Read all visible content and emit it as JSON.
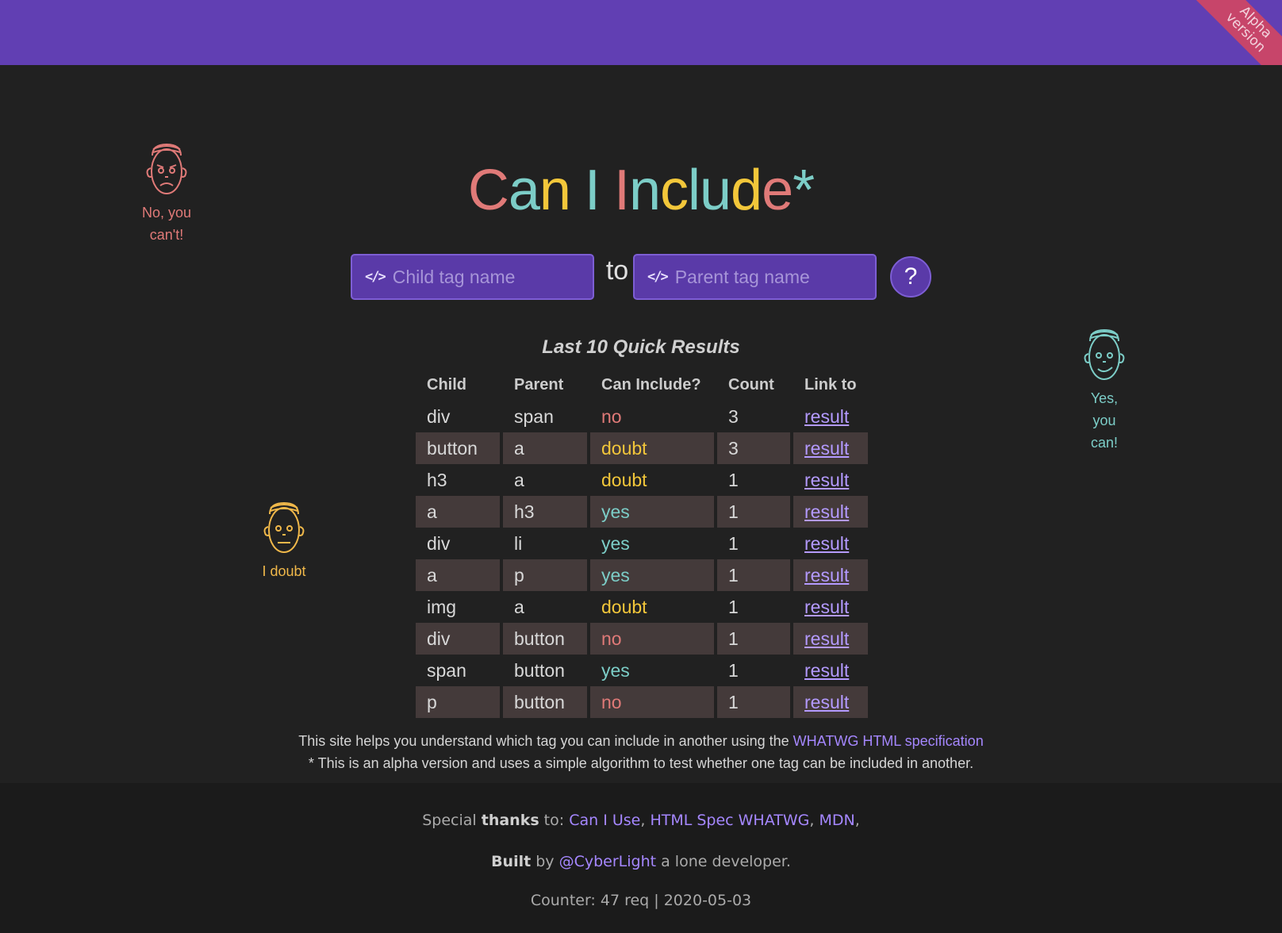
{
  "header": {
    "ribbon": "Alpha\nversion"
  },
  "title": {
    "letters": [
      "C",
      "a",
      "n",
      " ",
      "I",
      " ",
      "I",
      "n",
      "c",
      "l",
      "u",
      "d",
      "e",
      "*"
    ],
    "colors": [
      "#e07a78",
      "#7ccdc7",
      "#f3c73a",
      "",
      "#7ccdc7",
      "",
      "#e07a78",
      "#7ccdc7",
      "#f3c73a",
      "#7ccdc7",
      "#7ccdc7",
      "#f3c73a",
      "#e07a78",
      "#7ccdc7"
    ]
  },
  "search": {
    "child_placeholder": "Child tag name",
    "child_value": "",
    "to_label": "to",
    "parent_placeholder": "Parent tag name",
    "parent_value": "",
    "help_label": "?",
    "input_icon": "code-icon"
  },
  "faces": {
    "no": {
      "label": "No, you can't!",
      "color": "#e07a78"
    },
    "doubt": {
      "label": "I doubt",
      "color": "#f0b84a"
    },
    "yes": {
      "label": "Yes, you can!",
      "color": "#7ccdc7"
    }
  },
  "results": {
    "title": "Last 10 Quick Results",
    "headers": [
      "Child",
      "Parent",
      "Can Include?",
      "Count",
      "Link to"
    ],
    "rows": [
      {
        "child": "div",
        "parent": "span",
        "include": "no",
        "count": "3",
        "link": "result"
      },
      {
        "child": "button",
        "parent": "a",
        "include": "doubt",
        "count": "3",
        "link": "result"
      },
      {
        "child": "h3",
        "parent": "a",
        "include": "doubt",
        "count": "1",
        "link": "result"
      },
      {
        "child": "a",
        "parent": "h3",
        "include": "yes",
        "count": "1",
        "link": "result"
      },
      {
        "child": "div",
        "parent": "li",
        "include": "yes",
        "count": "1",
        "link": "result"
      },
      {
        "child": "a",
        "parent": "p",
        "include": "yes",
        "count": "1",
        "link": "result"
      },
      {
        "child": "img",
        "parent": "a",
        "include": "doubt",
        "count": "1",
        "link": "result"
      },
      {
        "child": "div",
        "parent": "button",
        "include": "no",
        "count": "1",
        "link": "result"
      },
      {
        "child": "span",
        "parent": "button",
        "include": "yes",
        "count": "1",
        "link": "result"
      },
      {
        "child": "p",
        "parent": "button",
        "include": "no",
        "count": "1",
        "link": "result"
      }
    ]
  },
  "info": {
    "line1_prefix": "This site helps you understand which tag you can include in another using the ",
    "line1_link": "WHATWG HTML specification",
    "line2": "* This is an alpha version and uses a simple algorithm to test whether one tag can be included in another."
  },
  "footer": {
    "thanks_prefix": "Special ",
    "thanks_bold": "thanks",
    "thanks_to": " to: ",
    "thanks_links": [
      "Can I Use",
      "HTML Spec WHATWG",
      "MDN"
    ],
    "built_bold": "Built",
    "built_by": " by ",
    "built_link": "@CyberLight",
    "built_suffix": " a lone developer.",
    "counter": "Counter: 47 req | 2020-05-03"
  },
  "colors": {
    "no": "#e07a78",
    "doubt": "#f3c73a",
    "yes": "#7ccdc7",
    "accent": "#613fb3",
    "link": "#a587ff"
  }
}
